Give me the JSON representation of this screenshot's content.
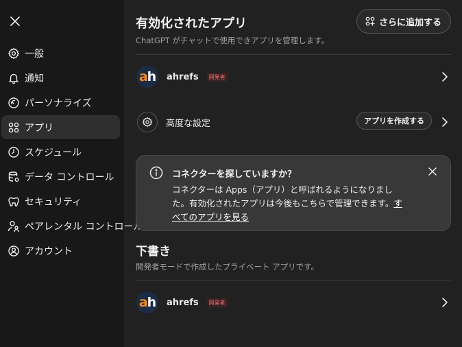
{
  "sidebar": {
    "close_icon": "close-icon",
    "items": [
      {
        "label": "一般",
        "icon": "gear-icon"
      },
      {
        "label": "通知",
        "icon": "bell-icon"
      },
      {
        "label": "パーソナライズ",
        "icon": "personalize-icon"
      },
      {
        "label": "アプリ",
        "icon": "apps-grid-icon",
        "active": true
      },
      {
        "label": "スケジュール",
        "icon": "clock-icon"
      },
      {
        "label": "データ コントロール",
        "icon": "database-icon"
      },
      {
        "label": "セキュリティ",
        "icon": "shield-icon"
      },
      {
        "label": "ペアレンタル コントロール",
        "icon": "parental-icon"
      },
      {
        "label": "アカウント",
        "icon": "account-icon"
      }
    ]
  },
  "main": {
    "title": "有効化されたアプリ",
    "subtitle": "ChatGPT がチャットで使用できアプリを管理します。",
    "add_button": "さらに追加する",
    "enabled_apps": [
      {
        "name": "ahrefs",
        "badge": "開発者"
      }
    ],
    "advanced": {
      "label": "高度な設定",
      "create_button": "アプリを作成する"
    },
    "notice": {
      "title": "コネクターを探していますか？",
      "body": "コネクターは Apps（アプリ）と呼ばれるようになりました。有効化されたアプリは今後もこちらで管理できます。",
      "link": "すべてのアプリを見る"
    },
    "drafts": {
      "title": "下書き",
      "subtitle": "開発者モードで作成したプライベート アプリです。",
      "apps": [
        {
          "name": "ahrefs",
          "badge": "開発者"
        }
      ]
    }
  },
  "colors": {
    "background": "#212121",
    "sidebar": "#181818",
    "active_item": "#2f2f2f",
    "badge_text": "#e26a6a",
    "logo_accent": "#f28b1e",
    "logo_bg": "#1c2c44"
  }
}
